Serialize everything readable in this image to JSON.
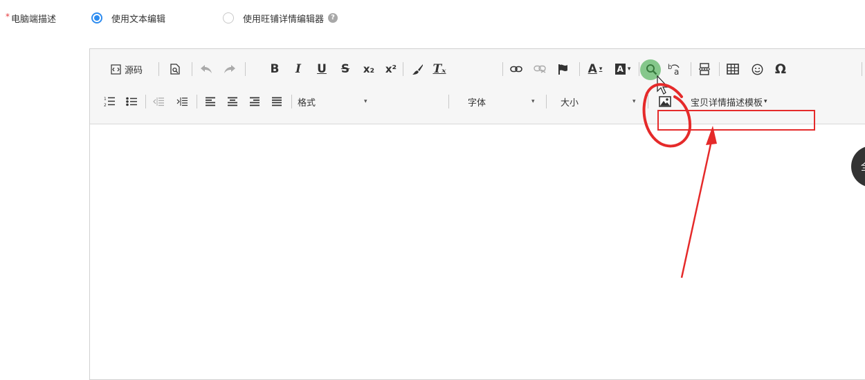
{
  "field": {
    "required_mark": "*",
    "label": "电脑端描述"
  },
  "radios": [
    {
      "label": "使用文本编辑",
      "checked": true
    },
    {
      "label": "使用旺铺详情编辑器",
      "checked": false
    }
  ],
  "help_glyph": "?",
  "toolbar": {
    "source_label": "源码",
    "glyphs": {
      "bold": "B",
      "italic": "I",
      "underline": "U",
      "strike": "S",
      "subscript": "x₂",
      "superscript": "x²",
      "remove_format": "Tₓ",
      "font_color": "A",
      "bg_color": "A",
      "special_char": "Ω"
    },
    "format_label": "格式",
    "font_label": "字体",
    "size_label": "大小",
    "template_label": "宝贝详情描述模板",
    "dropdown_caret": "▾"
  },
  "fullscreen_label": "全",
  "icons": [
    "source-icon",
    "preview-icon",
    "undo-icon",
    "redo-icon",
    "paint-brush-icon",
    "link-icon",
    "unlink-icon",
    "flag-icon",
    "search-icon",
    "replace-icon",
    "page-break-icon",
    "table-icon",
    "smiley-icon",
    "ordered-list-icon",
    "bullet-list-icon",
    "outdent-icon",
    "indent-icon",
    "align-left-icon",
    "align-center-icon",
    "align-right-icon",
    "justify-icon",
    "image-icon"
  ],
  "colors": {
    "accent": "#2d8cf0",
    "required": "#e4393c",
    "annotation_red": "#e52a2a",
    "toolbar_bg": "#f6f6f6"
  }
}
